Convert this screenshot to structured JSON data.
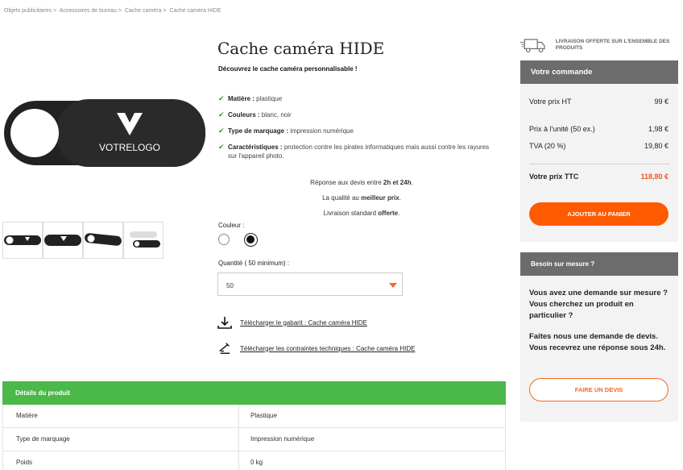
{
  "breadcrumb": [
    "Objets publicitaires >",
    "Accessoires de bureau >",
    "Cache caméra >",
    "Cache caméra HIDE"
  ],
  "product": {
    "title": "Cache caméra HIDE",
    "subtitle": "Découvrez le cache caméra personnalisable !",
    "logo_text": "VOTRELOGO",
    "features": [
      {
        "key": "Matière :",
        "value": " plastique"
      },
      {
        "key": "Couleurs :",
        "value": " blanc, noir"
      },
      {
        "key": "Type de marquage :",
        "value": " impression numérique"
      },
      {
        "key": "Caractéristiques :",
        "value": " protection contre les pirates informatiques mais aussi contre les rayures sur l'appareil photo."
      }
    ],
    "info": {
      "line1_pre": "Réponse aux devis entre ",
      "line1_bold": "2h et 24h",
      "line1_post": ".",
      "line2_pre": "La qualité au ",
      "line2_bold": "meilleur prix",
      "line2_post": ".",
      "line3_pre": "Livraison standard ",
      "line3_bold": "offerte",
      "line3_post": "."
    },
    "color_label": "Couleur :",
    "quantity_label": "Quantité ( 50 minimum) :",
    "quantity_value": "50",
    "download_template": "Télécharger le gabarit : Cache caméra HIDE",
    "download_constraints": "Télécharger les contraintes techniques : Cache caméra HIDE"
  },
  "details": {
    "title": "Détails du produit",
    "rows": [
      {
        "key": "Matière",
        "value": "Plastique"
      },
      {
        "key": "Type de marquage",
        "value": "Impression numérique"
      },
      {
        "key": "Poids",
        "value": "0 kg"
      }
    ]
  },
  "shipping": {
    "text": "Livraison offerte sur l'ensemble des produits"
  },
  "order": {
    "title": "Votre commande",
    "price_ht_label": "Votre prix HT",
    "price_ht_value": "99 €",
    "unit_label": "Prix à l'unité (50 ex.)",
    "unit_value": "1,98 €",
    "tva_label": "TVA (20 %)",
    "tva_value": "19,80 €",
    "ttc_label": "Votre prix TTC",
    "ttc_value": "118,80 €",
    "cart_button": "Ajouter au panier"
  },
  "custom": {
    "title": "Besoin sur mesure ?",
    "text1": "Vous avez une demande sur mesure ? Vous cherchez un produit en particulier ?",
    "text2": "Faites nous une demande de devis. Vous recevrez une réponse sous 24h.",
    "button": "Faire un devis"
  },
  "colors": {
    "accent": "#ff5a00",
    "green": "#4bb84a",
    "grey_head": "#6c6c6c"
  }
}
